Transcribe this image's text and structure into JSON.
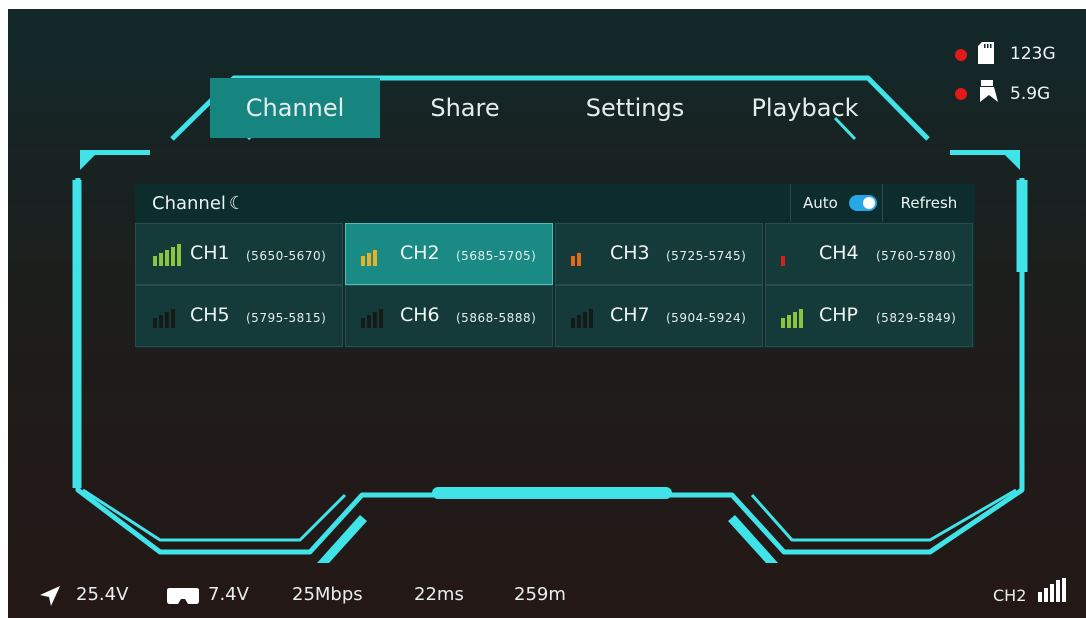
{
  "tabs": [
    {
      "label": "Channel",
      "active": true
    },
    {
      "label": "Share",
      "active": false
    },
    {
      "label": "Settings",
      "active": false
    },
    {
      "label": "Playback",
      "active": false
    }
  ],
  "storage": {
    "sd_card": {
      "value": "123G",
      "icon": "sd-card-icon",
      "status_color": "#e31818"
    },
    "internal": {
      "value": "5.9G",
      "icon": "storage-icon",
      "status_color": "#e31818"
    }
  },
  "panel": {
    "title": "Channel",
    "auto_label": "Auto",
    "auto_enabled": true,
    "refresh_label": "Refresh"
  },
  "channels": [
    {
      "name": "CH1",
      "range": "(5650-5670)",
      "signal": 5,
      "color": "#8bc53f",
      "selected": false
    },
    {
      "name": "CH2",
      "range": "(5685-5705)",
      "signal": 3,
      "color": "#e8b12a",
      "selected": true
    },
    {
      "name": "CH3",
      "range": "(5725-5745)",
      "signal": 2,
      "color": "#e06a1a",
      "selected": false
    },
    {
      "name": "CH4",
      "range": "(5760-5780)",
      "signal": 1,
      "color": "#d81f1f",
      "selected": false
    },
    {
      "name": "CH5",
      "range": "(5795-5815)",
      "signal": 0,
      "color": "#8bc53f",
      "selected": false
    },
    {
      "name": "CH6",
      "range": "(5868-5888)",
      "signal": 0,
      "color": "#8bc53f",
      "selected": false
    },
    {
      "name": "CH7",
      "range": "(5904-5924)",
      "signal": 0,
      "color": "#8bc53f",
      "selected": false
    },
    {
      "name": "CHP",
      "range": "(5829-5849)",
      "signal": 4,
      "color": "#8bc53f",
      "selected": false
    }
  ],
  "status": {
    "gps_voltage": "25.4V",
    "goggle_voltage": "7.4V",
    "bitrate": "25Mbps",
    "latency": "22ms",
    "distance": "259m",
    "current_channel": "CH2"
  },
  "colors": {
    "accent": "#3fe3e8",
    "tab_active": "#17857f",
    "cell_selected": "#1a8a84",
    "bar_inactive": "#141a18"
  }
}
